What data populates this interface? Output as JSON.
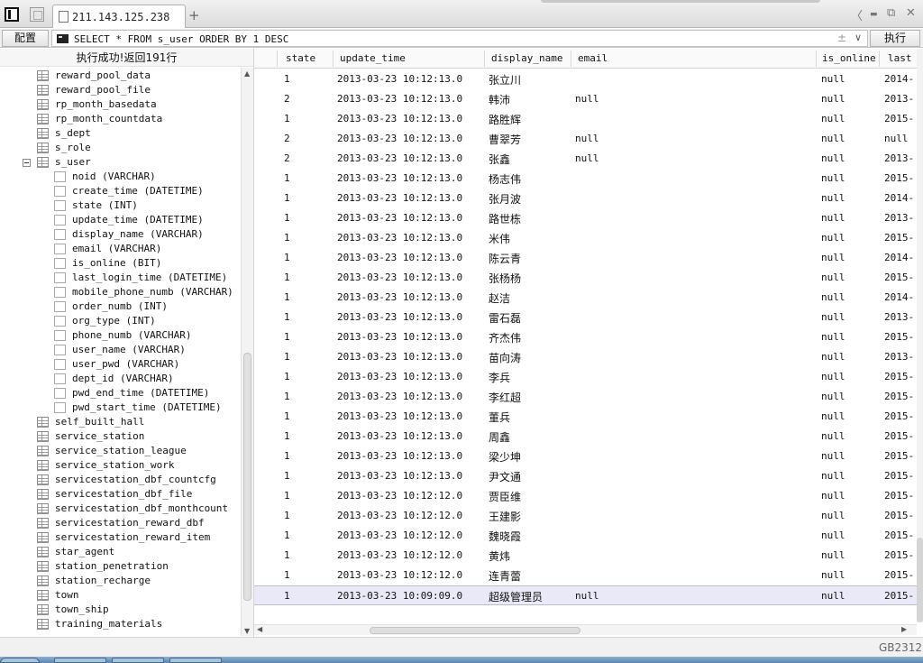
{
  "titlebar": {
    "tab_label": "211.143.125.238",
    "add_tab": "+",
    "nav_back": "〈",
    "minimize": "▬",
    "restore": "⧉",
    "close": "✕"
  },
  "toolbar": {
    "config_label": "配置",
    "sql_text": "SELECT * FROM s_user ORDER BY 1 DESC",
    "plusminus": "±",
    "dropdown": "∨",
    "execute_label": "执行"
  },
  "left_panel": {
    "status": "执行成功!返回191行",
    "tree": [
      {
        "label": "reward_pool_data",
        "kind": "table",
        "level": 0
      },
      {
        "label": "reward_pool_file",
        "kind": "table",
        "level": 0
      },
      {
        "label": "rp_month_basedata",
        "kind": "table",
        "level": 0
      },
      {
        "label": "rp_month_countdata",
        "kind": "table",
        "level": 0
      },
      {
        "label": "s_dept",
        "kind": "table",
        "level": 0
      },
      {
        "label": "s_role",
        "kind": "table",
        "level": 0
      },
      {
        "label": "s_user",
        "kind": "table",
        "level": 0,
        "expanded": true
      },
      {
        "label": "noid (VARCHAR)",
        "kind": "column",
        "level": 1
      },
      {
        "label": "create_time (DATETIME)",
        "kind": "column",
        "level": 1
      },
      {
        "label": "state (INT)",
        "kind": "column",
        "level": 1
      },
      {
        "label": "update_time (DATETIME)",
        "kind": "column",
        "level": 1
      },
      {
        "label": "display_name (VARCHAR)",
        "kind": "column",
        "level": 1
      },
      {
        "label": "email (VARCHAR)",
        "kind": "column",
        "level": 1
      },
      {
        "label": "is_online (BIT)",
        "kind": "column",
        "level": 1
      },
      {
        "label": "last_login_time (DATETIME)",
        "kind": "column",
        "level": 1
      },
      {
        "label": "mobile_phone_numb (VARCHAR)",
        "kind": "column",
        "level": 1
      },
      {
        "label": "order_numb (INT)",
        "kind": "column",
        "level": 1
      },
      {
        "label": "org_type (INT)",
        "kind": "column",
        "level": 1
      },
      {
        "label": "phone_numb (VARCHAR)",
        "kind": "column",
        "level": 1
      },
      {
        "label": "user_name (VARCHAR)",
        "kind": "column",
        "level": 1
      },
      {
        "label": "user_pwd (VARCHAR)",
        "kind": "column",
        "level": 1
      },
      {
        "label": "dept_id (VARCHAR)",
        "kind": "column",
        "level": 1
      },
      {
        "label": "pwd_end_time (DATETIME)",
        "kind": "column",
        "level": 1
      },
      {
        "label": "pwd_start_time (DATETIME)",
        "kind": "column",
        "level": 1
      },
      {
        "label": "self_built_hall",
        "kind": "table",
        "level": 0
      },
      {
        "label": "service_station",
        "kind": "table",
        "level": 0
      },
      {
        "label": "service_station_league",
        "kind": "table",
        "level": 0
      },
      {
        "label": "service_station_work",
        "kind": "table",
        "level": 0
      },
      {
        "label": "servicestation_dbf_countcfg",
        "kind": "table",
        "level": 0
      },
      {
        "label": "servicestation_dbf_file",
        "kind": "table",
        "level": 0
      },
      {
        "label": "servicestation_dbf_monthcount",
        "kind": "table",
        "level": 0
      },
      {
        "label": "servicestation_reward_dbf",
        "kind": "table",
        "level": 0
      },
      {
        "label": "servicestation_reward_item",
        "kind": "table",
        "level": 0
      },
      {
        "label": "star_agent",
        "kind": "table",
        "level": 0
      },
      {
        "label": "station_penetration",
        "kind": "table",
        "level": 0
      },
      {
        "label": "station_recharge",
        "kind": "table",
        "level": 0
      },
      {
        "label": "town",
        "kind": "table",
        "level": 0
      },
      {
        "label": "town_ship",
        "kind": "table",
        "level": 0
      },
      {
        "label": "training_materials",
        "kind": "table",
        "level": 0
      }
    ]
  },
  "grid": {
    "columns": [
      "state",
      "update_time",
      "display_name",
      "email",
      "is_online",
      "last"
    ],
    "rows": [
      [
        "1",
        "2013-03-23 10:12:13.0",
        "张立川",
        "",
        "null",
        "2014-"
      ],
      [
        "2",
        "2013-03-23 10:12:13.0",
        "韩沛",
        "null",
        "null",
        "2013-"
      ],
      [
        "1",
        "2013-03-23 10:12:13.0",
        "路胜辉",
        "",
        "null",
        "2015-"
      ],
      [
        "2",
        "2013-03-23 10:12:13.0",
        "曹翠芳",
        "null",
        "null",
        "null"
      ],
      [
        "2",
        "2013-03-23 10:12:13.0",
        "张鑫",
        "null",
        "null",
        "2013-"
      ],
      [
        "1",
        "2013-03-23 10:12:13.0",
        "杨志伟",
        "",
        "null",
        "2015-"
      ],
      [
        "1",
        "2013-03-23 10:12:13.0",
        "张月波",
        "",
        "null",
        "2014-"
      ],
      [
        "1",
        "2013-03-23 10:12:13.0",
        "路世栋",
        "",
        "null",
        "2013-"
      ],
      [
        "1",
        "2013-03-23 10:12:13.0",
        "米伟",
        "",
        "null",
        "2015-"
      ],
      [
        "1",
        "2013-03-23 10:12:13.0",
        "陈云青",
        "",
        "null",
        "2014-"
      ],
      [
        "1",
        "2013-03-23 10:12:13.0",
        "张杨杨",
        "",
        "null",
        "2015-"
      ],
      [
        "1",
        "2013-03-23 10:12:13.0",
        "赵洁",
        "",
        "null",
        "2014-"
      ],
      [
        "1",
        "2013-03-23 10:12:13.0",
        "雷石磊",
        "",
        "null",
        "2013-"
      ],
      [
        "1",
        "2013-03-23 10:12:13.0",
        "齐杰伟",
        "",
        "null",
        "2015-"
      ],
      [
        "1",
        "2013-03-23 10:12:13.0",
        "苗向涛",
        "",
        "null",
        "2013-"
      ],
      [
        "1",
        "2013-03-23 10:12:13.0",
        "李兵",
        "",
        "null",
        "2015-"
      ],
      [
        "1",
        "2013-03-23 10:12:13.0",
        "李红超",
        "",
        "null",
        "2015-"
      ],
      [
        "1",
        "2013-03-23 10:12:13.0",
        "董兵",
        "",
        "null",
        "2015-"
      ],
      [
        "1",
        "2013-03-23 10:12:13.0",
        "周鑫",
        "",
        "null",
        "2015-"
      ],
      [
        "1",
        "2013-03-23 10:12:13.0",
        "梁少坤",
        "",
        "null",
        "2015-"
      ],
      [
        "1",
        "2013-03-23 10:12:13.0",
        "尹文通",
        "",
        "null",
        "2015-"
      ],
      [
        "1",
        "2013-03-23 10:12:12.0",
        "贾臣维",
        "",
        "null",
        "2015-"
      ],
      [
        "1",
        "2013-03-23 10:12:12.0",
        "王建影",
        "",
        "null",
        "2015-"
      ],
      [
        "1",
        "2013-03-23 10:12:12.0",
        "魏晓霞",
        "",
        "null",
        "2015-"
      ],
      [
        "1",
        "2013-03-23 10:12:12.0",
        "黄炜",
        "",
        "null",
        "2015-"
      ],
      [
        "1",
        "2013-03-23 10:12:12.0",
        "连青蕾",
        "",
        "null",
        "2015-"
      ],
      [
        "1",
        "2013-03-23 10:09:09.0",
        "超级管理员",
        "null",
        "null",
        "2015-"
      ]
    ],
    "selected_row": 26
  },
  "statusbar": {
    "encoding": "GB2312"
  }
}
